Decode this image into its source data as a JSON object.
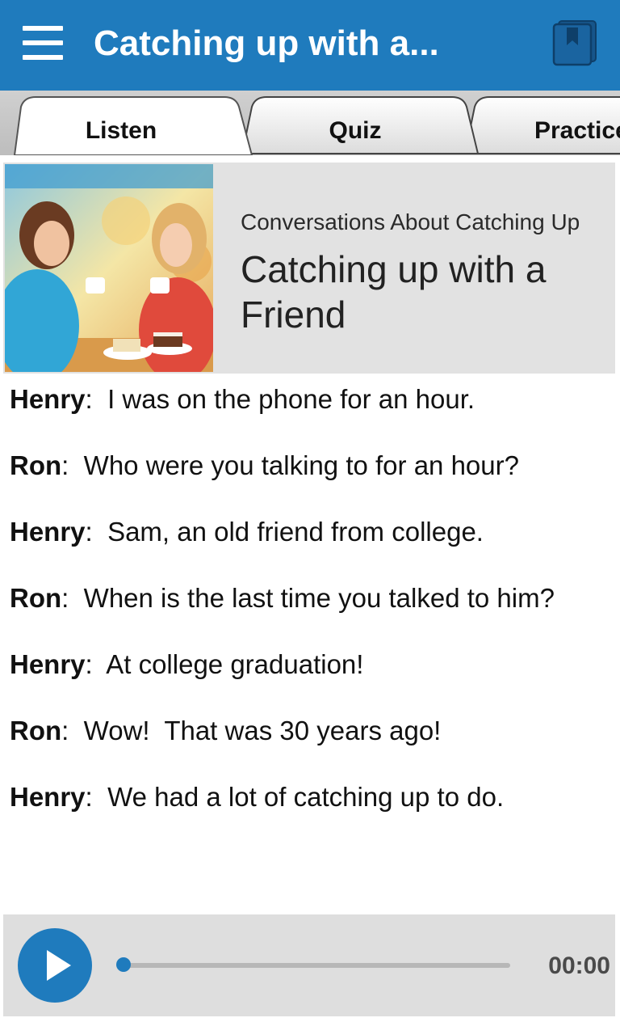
{
  "app_bar": {
    "title": "Catching up with a...",
    "menu_icon": "hamburger-menu-icon",
    "book_icon": "book-icon",
    "background_color": "#1f7bbd"
  },
  "tabs": [
    {
      "label": "Listen",
      "selected": true
    },
    {
      "label": "Quiz",
      "selected": false
    },
    {
      "label": "Practice",
      "selected": false
    }
  ],
  "lesson": {
    "category": "Conversations About Catching Up",
    "title": "Catching up with a Friend",
    "photo": "two-women-chatting-over-tea-and-cake"
  },
  "dialog": [
    {
      "speaker": "Henry",
      "text": "I was on the phone for an hour."
    },
    {
      "speaker": "Ron",
      "text": "Who were you talking to for an hour?"
    },
    {
      "speaker": "Henry",
      "text": "Sam, an old friend from college."
    },
    {
      "speaker": "Ron",
      "text": "When is the last time you talked to him?"
    },
    {
      "speaker": "Henry",
      "text": "At college graduation!"
    },
    {
      "speaker": "Ron",
      "text": "Wow!  That was 30 years ago!"
    },
    {
      "speaker": "Henry",
      "text": "We had a lot of catching up to do."
    }
  ],
  "player": {
    "play_icon": "play-icon",
    "time": "00:00",
    "progress": 0,
    "accent_color": "#1f7bbd"
  }
}
